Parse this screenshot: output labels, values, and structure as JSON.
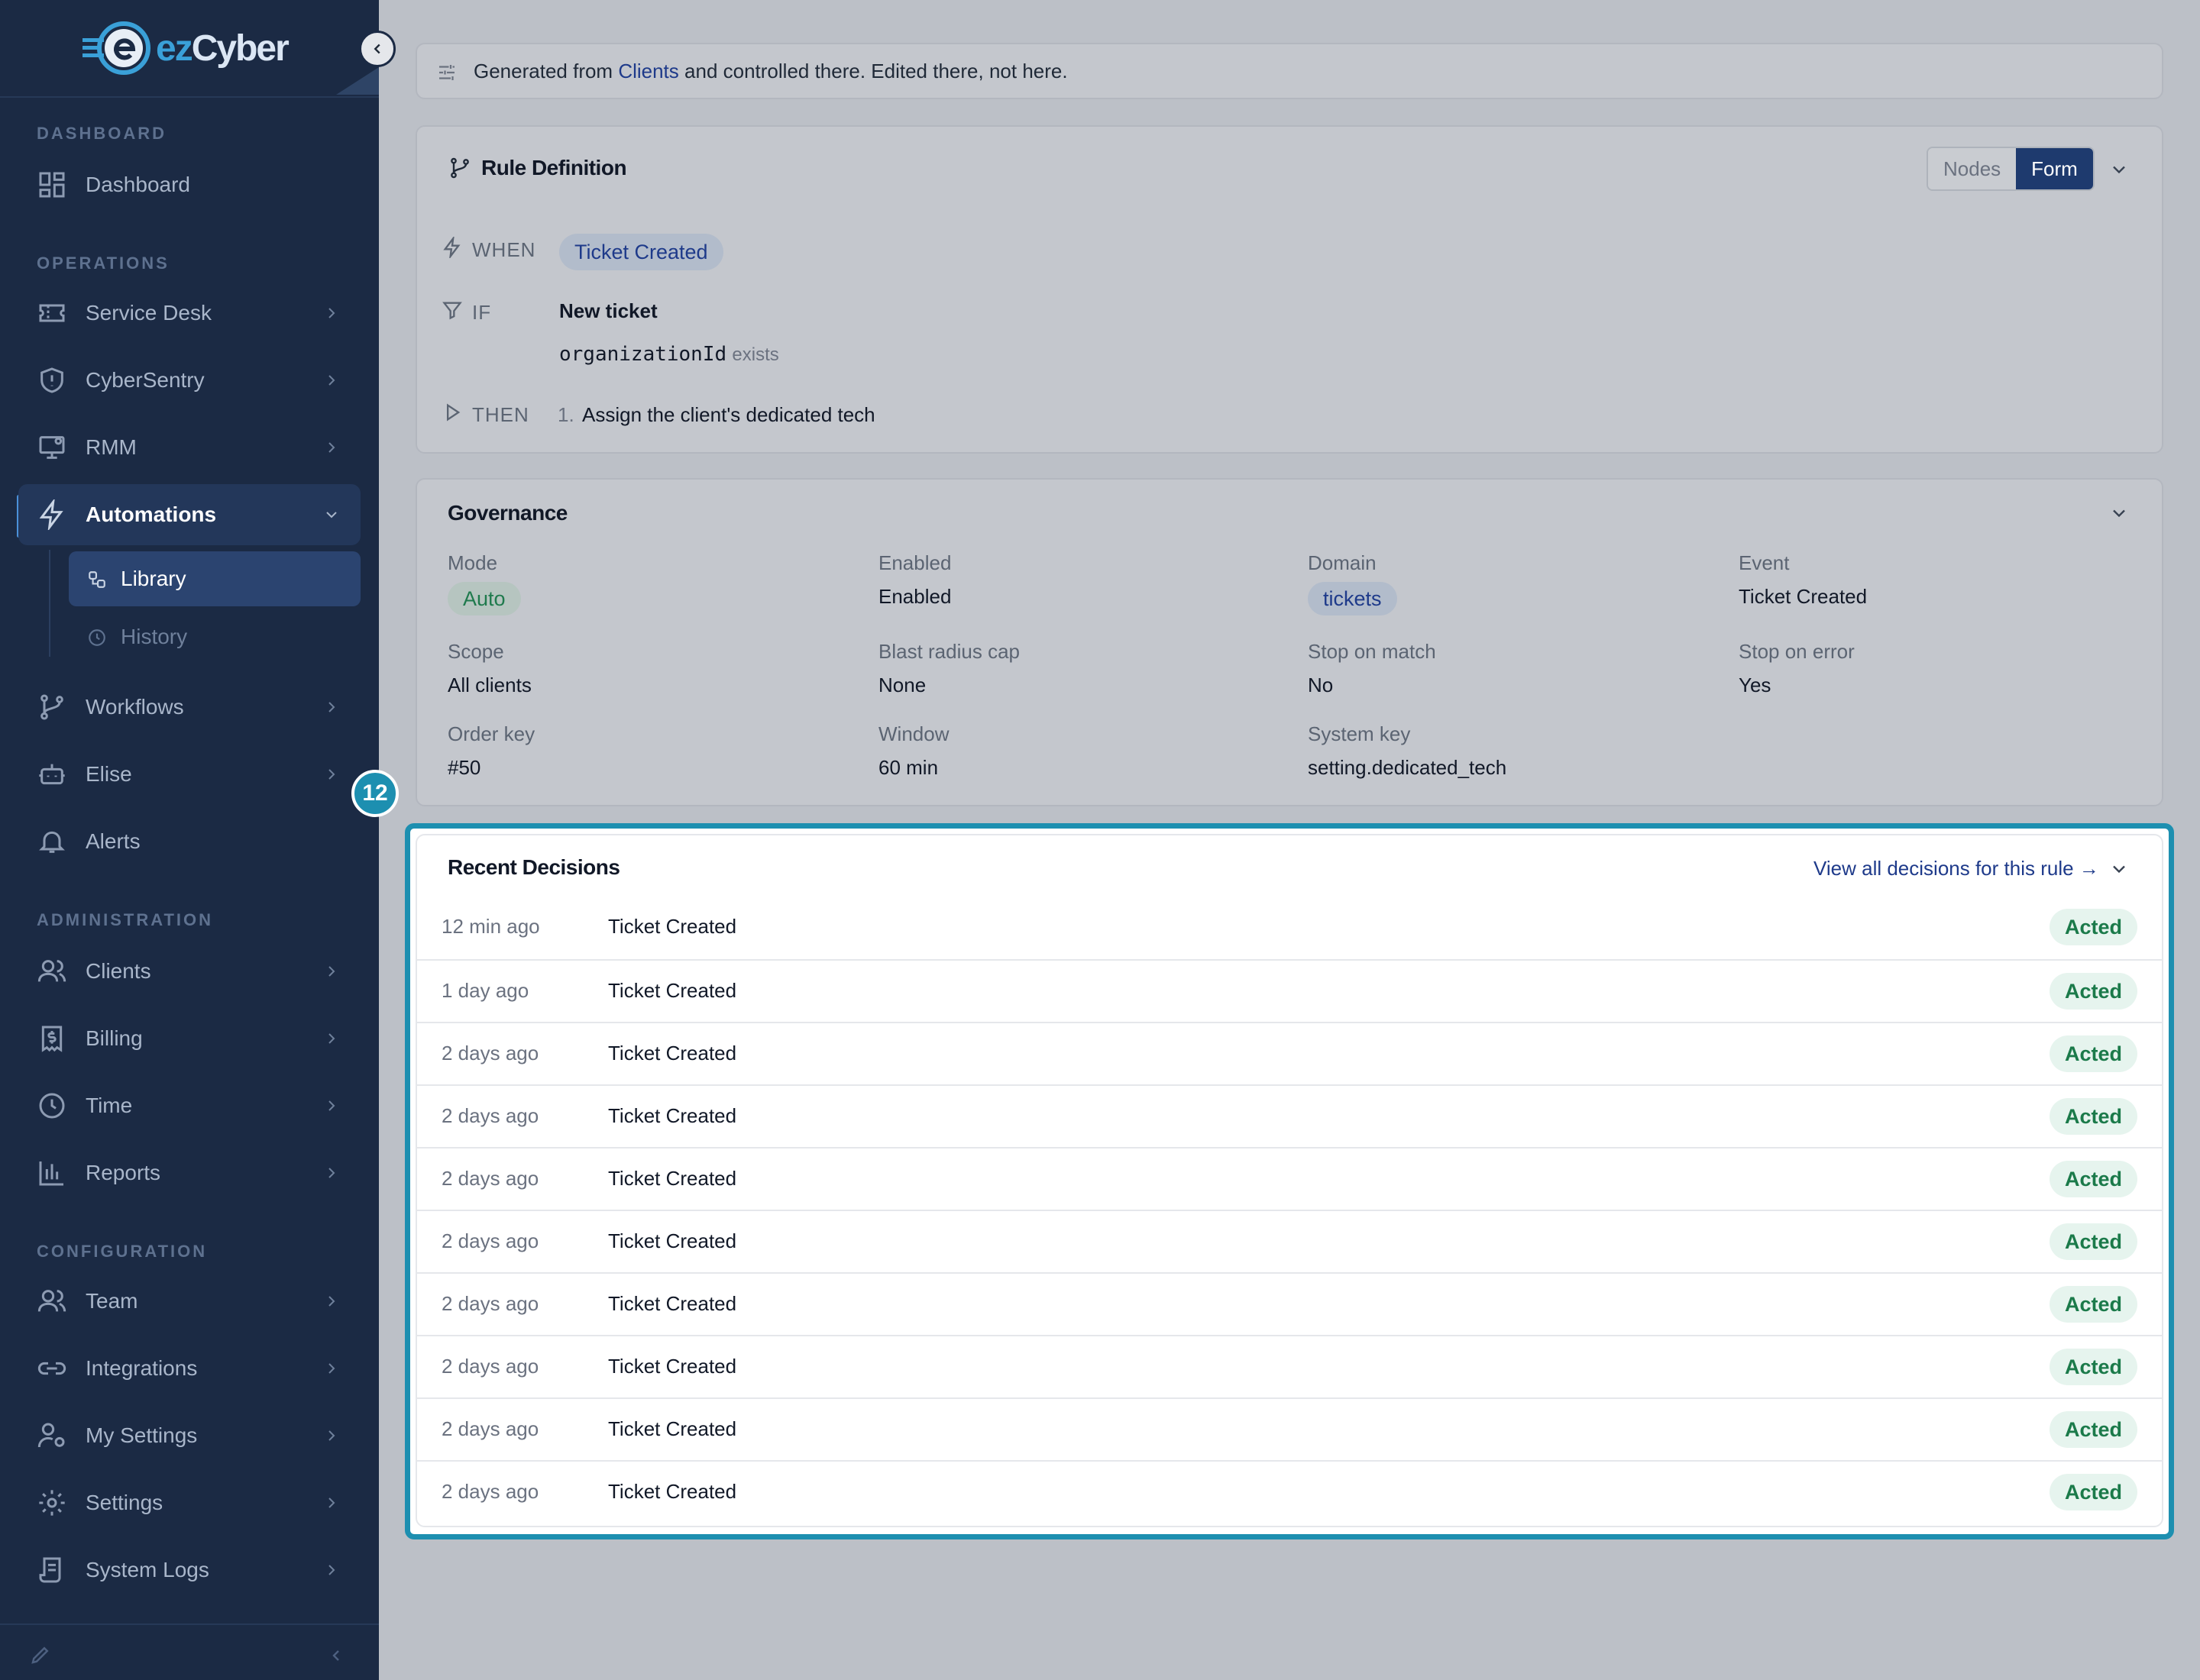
{
  "brand": {
    "name_prefix": "ez",
    "name_suffix": "Cyber"
  },
  "sidebar": {
    "sections": {
      "dashboard": "DASHBOARD",
      "operations": "OPERATIONS",
      "administration": "ADMINISTRATION",
      "configuration": "CONFIGURATION"
    },
    "items": {
      "dashboard": "Dashboard",
      "service_desk": "Service Desk",
      "cybersentry": "CyberSentry",
      "rmm": "RMM",
      "automations": "Automations",
      "library": "Library",
      "history": "History",
      "workflows": "Workflows",
      "elise": "Elise",
      "alerts": "Alerts",
      "clients": "Clients",
      "billing": "Billing",
      "time": "Time",
      "reports": "Reports",
      "team": "Team",
      "integrations": "Integrations",
      "my_settings": "My Settings",
      "settings": "Settings",
      "system_logs": "System Logs"
    }
  },
  "notice": {
    "prefix": "Generated from ",
    "link": "Clients",
    "suffix": " and controlled there. Edited there, not here."
  },
  "rule_definition": {
    "title": "Rule Definition",
    "view_options": [
      "Nodes",
      "Form"
    ],
    "selected_view": "Form",
    "when_label": "WHEN",
    "when_value": "Ticket Created",
    "if_label": "IF",
    "if_title": "New ticket",
    "if_field": "organizationId",
    "if_operator": "exists",
    "then_label": "THEN",
    "then_index": "1.",
    "then_action": "Assign the client's dedicated tech"
  },
  "governance": {
    "title": "Governance",
    "fields": {
      "mode": {
        "label": "Mode",
        "value": "Auto"
      },
      "enabled": {
        "label": "Enabled",
        "value": "Enabled"
      },
      "domain": {
        "label": "Domain",
        "value": "tickets"
      },
      "event": {
        "label": "Event",
        "value": "Ticket Created"
      },
      "scope": {
        "label": "Scope",
        "value": "All clients"
      },
      "blast": {
        "label": "Blast radius cap",
        "value": "None"
      },
      "stop_match": {
        "label": "Stop on match",
        "value": "No"
      },
      "stop_error": {
        "label": "Stop on error",
        "value": "Yes"
      },
      "order_key": {
        "label": "Order key",
        "value": "#50"
      },
      "window": {
        "label": "Window",
        "value": "60 min"
      },
      "system_key": {
        "label": "System key",
        "value": "setting.dedicated_tech"
      }
    }
  },
  "annotation": {
    "badge": "12"
  },
  "recent_decisions": {
    "title": "Recent Decisions",
    "view_all": "View all decisions for this rule →",
    "rows": [
      {
        "when": "12 min ago",
        "event": "Ticket Created",
        "status": "Acted"
      },
      {
        "when": "1 day ago",
        "event": "Ticket Created",
        "status": "Acted"
      },
      {
        "when": "2 days ago",
        "event": "Ticket Created",
        "status": "Acted"
      },
      {
        "when": "2 days ago",
        "event": "Ticket Created",
        "status": "Acted"
      },
      {
        "when": "2 days ago",
        "event": "Ticket Created",
        "status": "Acted"
      },
      {
        "when": "2 days ago",
        "event": "Ticket Created",
        "status": "Acted"
      },
      {
        "when": "2 days ago",
        "event": "Ticket Created",
        "status": "Acted"
      },
      {
        "when": "2 days ago",
        "event": "Ticket Created",
        "status": "Acted"
      },
      {
        "when": "2 days ago",
        "event": "Ticket Created",
        "status": "Acted"
      },
      {
        "when": "2 days ago",
        "event": "Ticket Created",
        "status": "Acted"
      }
    ]
  },
  "colors": {
    "sidebar": "#1b2a44",
    "accent": "#1d8fb0",
    "primary": "#1e3a6e",
    "success": "#1b7a4a"
  }
}
